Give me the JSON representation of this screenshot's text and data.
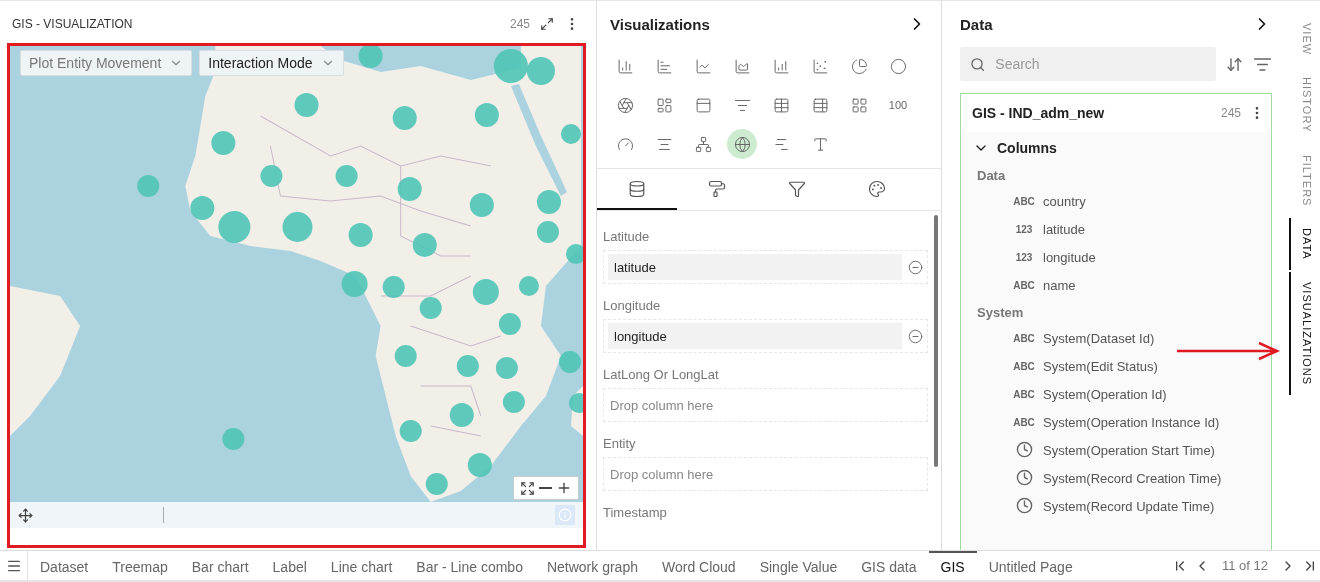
{
  "map_panel": {
    "title": "GIS - VISUALIZATION",
    "count": "245",
    "controls": [
      {
        "label": "Plot Entity Movement",
        "disabled": true
      },
      {
        "label": "Interaction Mode",
        "disabled": false
      }
    ]
  },
  "visualizations": {
    "title": "Visualizations",
    "types": [
      {
        "kind": "column",
        "selected": false
      },
      {
        "kind": "bar",
        "selected": false
      },
      {
        "kind": "line",
        "selected": false
      },
      {
        "kind": "area",
        "selected": false
      },
      {
        "kind": "combo",
        "selected": false
      },
      {
        "kind": "scatter",
        "selected": false
      },
      {
        "kind": "pie",
        "selected": false
      },
      {
        "kind": "donut",
        "selected": false
      },
      {
        "kind": "sunburst",
        "selected": false
      },
      {
        "kind": "treemap",
        "selected": false
      },
      {
        "kind": "pivot",
        "selected": false
      },
      {
        "kind": "filter",
        "selected": false
      },
      {
        "kind": "table",
        "selected": false
      },
      {
        "kind": "list",
        "selected": false
      },
      {
        "kind": "cards",
        "selected": false
      },
      {
        "kind": "number",
        "label": "100",
        "selected": false
      },
      {
        "kind": "gauge",
        "selected": false
      },
      {
        "kind": "cloud",
        "selected": false
      },
      {
        "kind": "network",
        "selected": false
      },
      {
        "kind": "map",
        "selected": true
      },
      {
        "kind": "steps",
        "selected": false
      },
      {
        "kind": "text",
        "selected": false
      }
    ],
    "config_tabs": [
      {
        "kind": "data",
        "selected": true
      },
      {
        "kind": "format",
        "selected": false
      },
      {
        "kind": "filter",
        "selected": false
      },
      {
        "kind": "palette",
        "selected": false
      }
    ],
    "fields": [
      {
        "label": "Latitude",
        "value": "latitude"
      },
      {
        "label": "Longitude",
        "value": "longitude"
      },
      {
        "label": "LatLong Or LongLat",
        "placeholder": "Drop column here"
      },
      {
        "label": "Entity",
        "placeholder": "Drop column here"
      },
      {
        "label": "Timestamp"
      }
    ]
  },
  "data": {
    "title": "Data",
    "search": {
      "placeholder": "Search"
    },
    "dataset": {
      "name": "GIS - IND_adm_new",
      "count": "245",
      "sections": [
        {
          "title": "Columns",
          "expanded": true,
          "groups": [
            {
              "title": "Data",
              "columns": [
                {
                  "kind": "text",
                  "badge": "ABC",
                  "name": "country"
                },
                {
                  "kind": "text",
                  "badge": "123",
                  "name": "latitude"
                },
                {
                  "kind": "text",
                  "badge": "123",
                  "name": "longitude"
                },
                {
                  "kind": "text",
                  "badge": "ABC",
                  "name": "name"
                }
              ]
            },
            {
              "title": "System",
              "columns": [
                {
                  "kind": "text",
                  "badge": "ABC",
                  "name": "System(Dataset Id)"
                },
                {
                  "kind": "text",
                  "badge": "ABC",
                  "name": "System(Edit Status)"
                },
                {
                  "kind": "text",
                  "badge": "ABC",
                  "name": "System(Operation Id)"
                },
                {
                  "kind": "text",
                  "badge": "ABC",
                  "name": "System(Operation Instance Id)"
                },
                {
                  "kind": "time",
                  "name": "System(Operation Start Time)"
                },
                {
                  "kind": "time",
                  "name": "System(Record Creation Time)"
                },
                {
                  "kind": "time",
                  "name": "System(Record Update Time)"
                }
              ]
            }
          ]
        }
      ]
    }
  },
  "side_tabs": [
    {
      "label": "VIEW",
      "selected": false
    },
    {
      "label": "HISTORY",
      "selected": false
    },
    {
      "label": "FILTERS",
      "selected": false
    },
    {
      "label": "DATA",
      "selected": true
    },
    {
      "label": "VISUALIZATIONS",
      "selected": true
    }
  ],
  "page_tabs": [
    {
      "label": "Dataset",
      "selected": false
    },
    {
      "label": "Treemap",
      "selected": false
    },
    {
      "label": "Bar chart",
      "selected": false
    },
    {
      "label": "Label",
      "selected": false
    },
    {
      "label": "Line chart",
      "selected": false
    },
    {
      "label": "Bar - Line combo",
      "selected": false
    },
    {
      "label": "Network graph",
      "selected": false
    },
    {
      "label": "Word Cloud",
      "selected": false
    },
    {
      "label": "Single Value",
      "selected": false
    },
    {
      "label": "GIS data",
      "selected": false
    },
    {
      "label": "GIS",
      "selected": true
    },
    {
      "label": "Untitled Page",
      "selected": false
    }
  ],
  "pager": "11 of 12"
}
